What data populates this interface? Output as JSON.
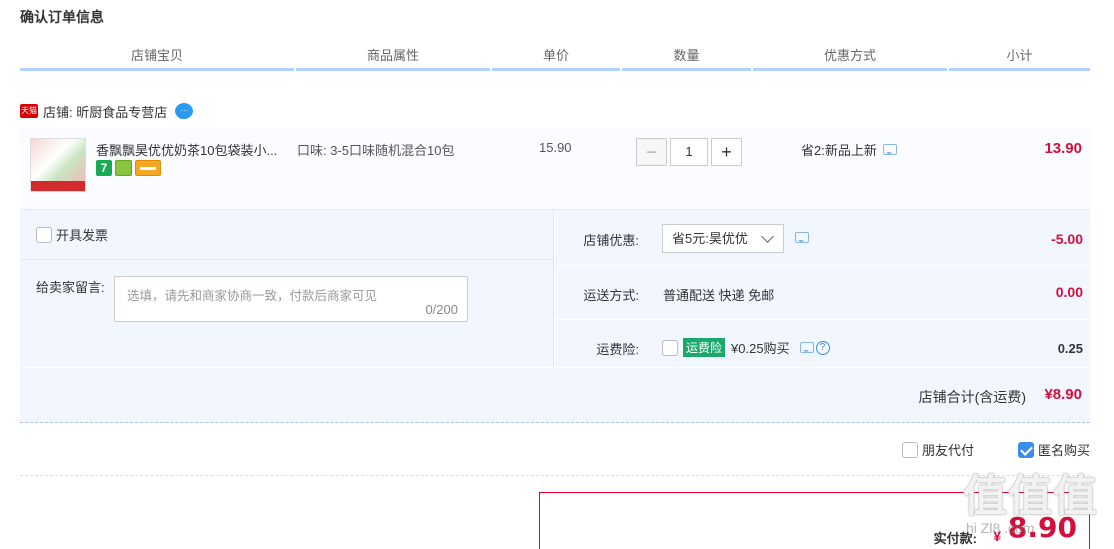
{
  "page": {
    "title": "确认订单信息"
  },
  "headers": [
    "店铺宝贝",
    "商品属性",
    "单价",
    "数量",
    "优惠方式",
    "小计"
  ],
  "shop": {
    "tag": "天猫",
    "label": "店铺: 昕厨食品专营店"
  },
  "item": {
    "title": "香飘飘昊优优奶茶10包袋装小...",
    "badge_seven": "7",
    "attribute": "口味: 3-5口味随机混合10包",
    "price": "15.90",
    "quantity": "1",
    "minus": "−",
    "plus": "+",
    "promo": "省2:新品上新",
    "subtotal": "13.90"
  },
  "invoice": {
    "label": "开具发票"
  },
  "message": {
    "label": "给卖家留言:",
    "placeholder": "选填，请先和商家协商一致，付款后商家可见",
    "counter": "0/200"
  },
  "discount": {
    "label": "店铺优惠:",
    "selected": "省5元:昊优优",
    "value": "-5.00"
  },
  "shipping": {
    "label": "运送方式:",
    "method": "普通配送 快递 免邮",
    "value": "0.00"
  },
  "insurance": {
    "label": "运费险:",
    "tag": "运费险",
    "text": "¥0.25购买",
    "help": "?",
    "value": "0.25"
  },
  "store_total": {
    "label": "店铺合计(含运费)",
    "value": "¥8.90"
  },
  "options": {
    "friend_pay": "朋友代付",
    "anonymous": "匿名购买"
  },
  "payment": {
    "label": "实付款:",
    "symbol": "¥",
    "value": "8.90"
  },
  "watermark": {
    "text": "值值值",
    "url": "hi Zl8 .com"
  }
}
